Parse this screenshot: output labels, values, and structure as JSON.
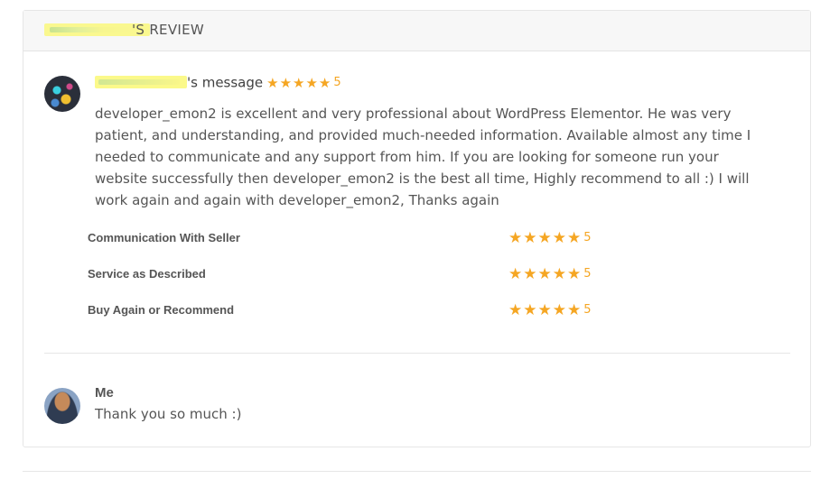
{
  "header": {
    "title": "'S REVIEW"
  },
  "review": {
    "name_suffix": "'s message",
    "overall_stars": "★★★★★",
    "overall_rating": "5",
    "message": "developer_emon2 is excellent and very professional about WordPress Elementor. He was very patient, and understanding, and provided much-needed information. Available almost any time I needed to communicate and any support from him. If you are looking for someone run your website successfully then developer_emon2 is the best all time, Highly recommend to all :) I will work again and again with developer_emon2, Thanks again"
  },
  "criteria": [
    {
      "label": "Communication With Seller",
      "stars": "★★★★★",
      "rating": "5"
    },
    {
      "label": "Service as Described",
      "stars": "★★★★★",
      "rating": "5"
    },
    {
      "label": "Buy Again or Recommend",
      "stars": "★★★★★",
      "rating": "5"
    }
  ],
  "reply": {
    "name": "Me",
    "text": "Thank you so much :)"
  },
  "colors": {
    "star": "#f5a623",
    "text": "#555555",
    "header_bg": "#f7f7f7"
  }
}
